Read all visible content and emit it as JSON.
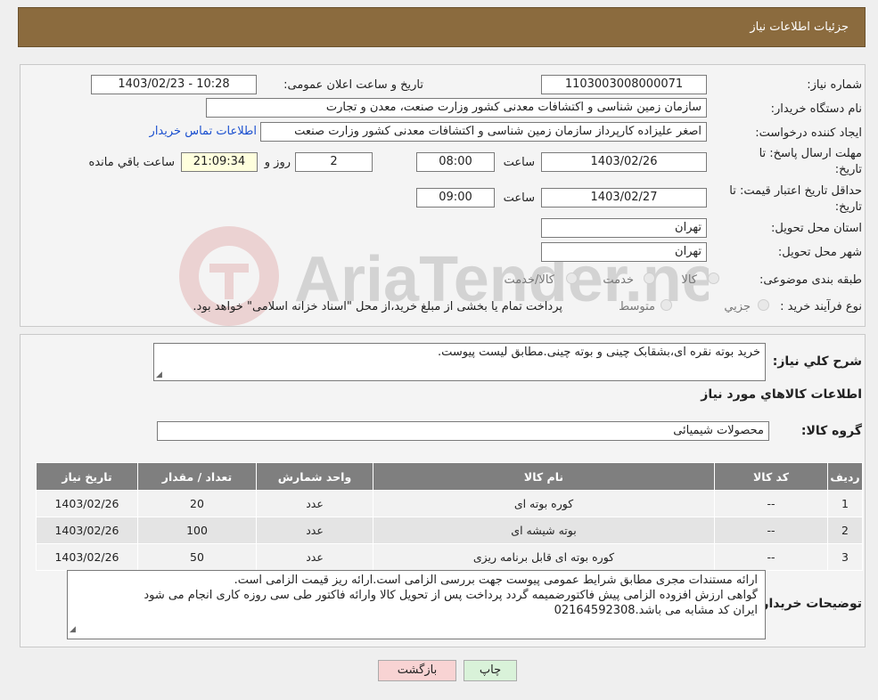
{
  "header": {
    "title": "جزئیات اطلاعات نیاز"
  },
  "form": {
    "need_number_label": "شماره نیاز:",
    "need_number": "1103003008000071",
    "announce_label": "تاریخ و ساعت اعلان عمومی:",
    "announce_value": "1403/02/23 - 10:28",
    "buyer_org_label": "نام دستگاه خریدار:",
    "buyer_org": "سازمان زمین شناسی و اکتشافات معدنی کشور وزارت صنعت، معدن و تجارت",
    "creator_label": "ایجاد کننده درخواست:",
    "creator": "اصغر علیزاده کارپرداز سازمان زمین شناسی و اکتشافات معدنی کشور وزارت صنعت",
    "contact_link": "اطلاعات تماس خریدار",
    "deadline_label_1": "مهلت ارسال پاسخ: تا",
    "deadline_label_2": "تاریخ:",
    "deadline_date": "1403/02/26",
    "time_label": "ساعت",
    "deadline_time": "08:00",
    "days_value": "2",
    "days_label": "روز و",
    "remaining_time": "21:09:34",
    "remaining_label": "ساعت باقي مانده",
    "validity_label_1": "حداقل تاریخ اعتبار قیمت: تا",
    "validity_label_2": "تاریخ:",
    "validity_date": "1403/02/27",
    "validity_time": "09:00",
    "province_label": "استان محل تحویل:",
    "province": "تهران",
    "city_label": "شهر محل تحویل:",
    "city": "تهران",
    "category_label": "طبقه بندی موضوعی:",
    "category_options": [
      "کالا",
      "خدمت",
      "کالا/خدمت"
    ],
    "process_label": "نوع فرآیند خرید :",
    "process_options": [
      "جزیي",
      "متوسط"
    ],
    "process_note": "پرداخت تمام یا بخشی از مبلغ خرید،از محل \"اسناد خزانه اسلامی\" خواهد بود."
  },
  "details": {
    "summary_label": "شرح کلي نياز:",
    "summary": "خرید بوته نقره ای،بشقابک چینی و بوته چینی.مطابق لیست پیوست.",
    "goods_info_title": "اطلاعات کالاهاي مورد نياز",
    "goods_group_label": "گروه کالا:",
    "goods_group": "محصولات شیمیائی"
  },
  "table": {
    "headers": [
      "رديف",
      "کد کالا",
      "نام کالا",
      "واحد شمارش",
      "تعداد / مقدار",
      "تاريخ نياز"
    ],
    "rows": [
      [
        "1",
        "--",
        "کوره بوته ای",
        "عدد",
        "20",
        "1403/02/26"
      ],
      [
        "2",
        "--",
        "بوته شیشه ای",
        "عدد",
        "100",
        "1403/02/26"
      ],
      [
        "3",
        "--",
        "کوره بوته ای قابل برنامه ریزی",
        "عدد",
        "50",
        "1403/02/26"
      ]
    ]
  },
  "buyer_notes": {
    "label": "توضیحات خریدار:",
    "lines": [
      "ارائه مستندات مجری مطابق شرایط عمومی پیوست جهت بررسی الزامی است.ارائه ریز قیمت الزامی است.",
      "گواهی ارزش افزوده الزامی پیش فاکتورضمیمه گردد پرداخت پس از تحویل کالا وارائه فاکتور طی سی روزه کاری انجام می شود",
      "ایران کد مشابه می باشد.02164592308"
    ]
  },
  "buttons": {
    "print": "چاپ",
    "back": "بازگشت"
  },
  "watermark": {
    "text": "AriaTender.neT"
  },
  "colors": {
    "header_bg": "#8b6b3e",
    "table_header_bg": "#7f7f7f",
    "link": "#1a4fcf",
    "back_button_bg": "#f8d3d3",
    "print_button_bg": "#d9f2d9"
  }
}
